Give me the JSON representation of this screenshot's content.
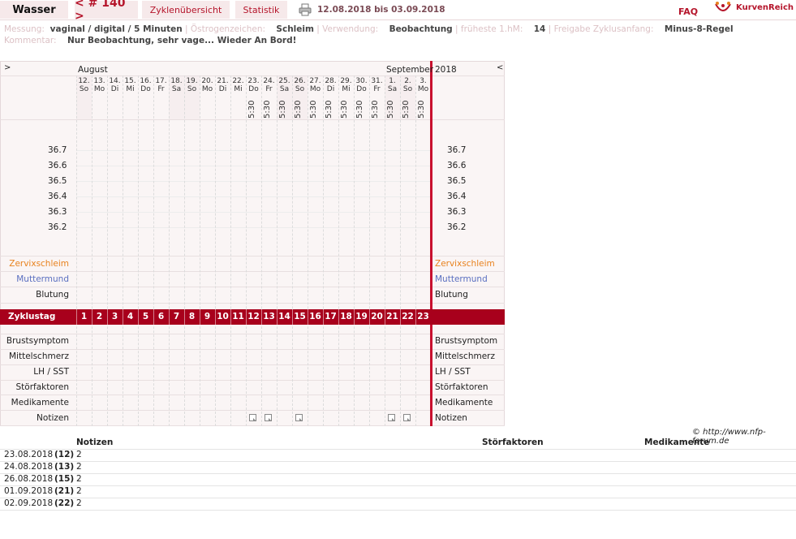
{
  "header": {
    "title": "Wasser",
    "cycle_nav": "< # 140 >",
    "tab_overview": "Zyklenübersicht",
    "tab_stats": "Statistik",
    "date_range": "12.08.2018 bis 03.09.2018",
    "faq": "FAQ",
    "brand": "KurvenReich"
  },
  "info": {
    "messung_label": "Messung:",
    "messung_value": "vaginal / digital / 5 Minuten",
    "oestrogen_label": "Östrogenzeichen:",
    "oestrogen_value": "Schleim",
    "verwendung_label": "Verwendung:",
    "verwendung_value": "Beobachtung",
    "frueheste_label": "früheste 1.hM:",
    "frueheste_value": "14",
    "freigabe_label": "Freigabe Zyklusanfang:",
    "freigabe_value": "Minus-8-Regel",
    "kommentar_label": "Kommentar:",
    "kommentar_value": "Nur Beobachtung, sehr vage... Wieder An Bord!"
  },
  "chart": {
    "nav_left": ">",
    "nav_right": "<",
    "month_aug": "August",
    "month_sep": "September",
    "year": "2018",
    "days": [
      {
        "d": "12.",
        "w": "So",
        "t": "",
        "hl": true
      },
      {
        "d": "13.",
        "w": "Mo",
        "t": "",
        "hl": false
      },
      {
        "d": "14.",
        "w": "Di",
        "t": "",
        "hl": false
      },
      {
        "d": "15.",
        "w": "Mi",
        "t": "",
        "hl": false
      },
      {
        "d": "16.",
        "w": "Do",
        "t": "",
        "hl": false
      },
      {
        "d": "17.",
        "w": "Fr",
        "t": "",
        "hl": false
      },
      {
        "d": "18.",
        "w": "Sa",
        "t": "",
        "hl": true
      },
      {
        "d": "19.",
        "w": "So",
        "t": "",
        "hl": true
      },
      {
        "d": "20.",
        "w": "Mo",
        "t": "",
        "hl": false
      },
      {
        "d": "21.",
        "w": "Di",
        "t": "",
        "hl": false
      },
      {
        "d": "22.",
        "w": "Mi",
        "t": "",
        "hl": false
      },
      {
        "d": "23.",
        "w": "Do",
        "t": "5:30",
        "hl": false
      },
      {
        "d": "24.",
        "w": "Fr",
        "t": "5:30",
        "hl": false
      },
      {
        "d": "25.",
        "w": "Sa",
        "t": "5:30",
        "hl": true
      },
      {
        "d": "26.",
        "w": "So",
        "t": "5:30",
        "hl": true
      },
      {
        "d": "27.",
        "w": "Mo",
        "t": "5:30",
        "hl": false
      },
      {
        "d": "28.",
        "w": "Di",
        "t": "5:30",
        "hl": false
      },
      {
        "d": "29.",
        "w": "Mi",
        "t": "5:30",
        "hl": false
      },
      {
        "d": "30.",
        "w": "Do",
        "t": "5:30",
        "hl": false
      },
      {
        "d": "31.",
        "w": "Fr",
        "t": "5:30",
        "hl": false
      },
      {
        "d": "1.",
        "w": "Sa",
        "t": "5:30",
        "hl": true
      },
      {
        "d": "2.",
        "w": "So",
        "t": "5:30",
        "hl": true
      },
      {
        "d": "3.",
        "w": "Mo",
        "t": "5:30",
        "hl": false
      }
    ],
    "temperatures": [
      "36.7",
      "36.6",
      "36.5",
      "36.4",
      "36.3",
      "36.2"
    ],
    "rows_top": [
      "Zervixschleim",
      "Muttermund",
      "Blutung"
    ],
    "zyklustag_label": "Zyklustag",
    "zyklustage": [
      "1",
      "2",
      "3",
      "4",
      "5",
      "6",
      "7",
      "8",
      "9",
      "10",
      "11",
      "12",
      "13",
      "14",
      "15",
      "16",
      "17",
      "18",
      "19",
      "20",
      "21",
      "22",
      "23"
    ],
    "rows_bottom": [
      "Brustsymptom",
      "Mittelschmerz",
      "LH / SST",
      "Störfaktoren",
      "Medikamente",
      "Notizen"
    ],
    "note_days": [
      12,
      13,
      15,
      21,
      22
    ],
    "colors": {
      "accent": "#a8001c",
      "zervix": "#e8821e",
      "muttermund": "#5a6fc0"
    }
  },
  "copyright": "© http://www.nfp-forum.de",
  "notes_table": {
    "headers": [
      "Notizen",
      "Störfaktoren",
      "Medikamente"
    ],
    "rows": [
      {
        "date": "23.08.2018",
        "day": "(12)",
        "note": "2"
      },
      {
        "date": "24.08.2018",
        "day": "(13)",
        "note": "2"
      },
      {
        "date": "26.08.2018",
        "day": "(15)",
        "note": "2"
      },
      {
        "date": "01.09.2018",
        "day": "(21)",
        "note": "2"
      },
      {
        "date": "02.09.2018",
        "day": "(22)",
        "note": "2"
      }
    ]
  }
}
